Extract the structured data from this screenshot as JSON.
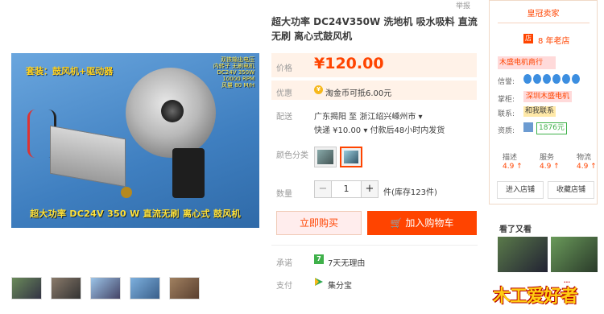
{
  "gallery": {
    "set_label": "套装：鼓风机+驱动器",
    "spec_text": "双铁输出电压\n内转子 无刷电机\nDC24V 350W\n10000 RPM\n风量 80 M/H",
    "caption": "超大功率 DC24V 350 W 直流无刷 离心式 鼓风机"
  },
  "product": {
    "title": "超大功率 DC24V350W 洗地机 吸水吸料 直流无刷 离心式鼓风机",
    "report_label": "举报",
    "price_label": "价格",
    "price": "¥120.00",
    "promo_label": "优惠",
    "promo_text": "淘金币可抵6.00元",
    "ship_label": "配送",
    "ship_route": "广东揭阳 至  浙江绍兴嵊州市  ▾",
    "ship_detail": "快递 ¥10.00  ▾  付款后48小时内发货",
    "color_label": "颜色分类",
    "qty_label": "数量",
    "qty_minus": "−",
    "qty_value": "1",
    "qty_plus": "+",
    "stock_text": "件(库存123件)",
    "buy_now": "立即购买",
    "add_cart": "加入购物车",
    "promise_label": "承诺",
    "promise_icon": "7",
    "promise_text": "7天无理由",
    "pay_label": "支付",
    "pay_text": "集分宝"
  },
  "shop": {
    "crown_title": "皇冠卖家",
    "years": "8 年老店",
    "years_icon": "店",
    "name": "木盛电机商行",
    "credit_label": "信誉:",
    "keeper_label": "掌柜:",
    "keeper": "深圳木盛电机",
    "contact_label": "联系:",
    "contact": "和我联系",
    "quali_label": "资质:",
    "quali_badge": "1876元",
    "ratings": [
      {
        "label": "描述",
        "value": "4.9 ↑"
      },
      {
        "label": "服务",
        "value": "4.9 ↑"
      },
      {
        "label": "物流",
        "value": "4.9 ↑"
      }
    ],
    "enter_shop": "进入店铺",
    "favorite_shop": "收藏店铺",
    "also_viewed": "看了又看"
  },
  "logo": {
    "text": "木工爱好者",
    "sub": "..."
  },
  "colors": {
    "accent": "#ff4400",
    "price_bg": "#fff2e8",
    "credit_blue": "#3c8ee0"
  }
}
